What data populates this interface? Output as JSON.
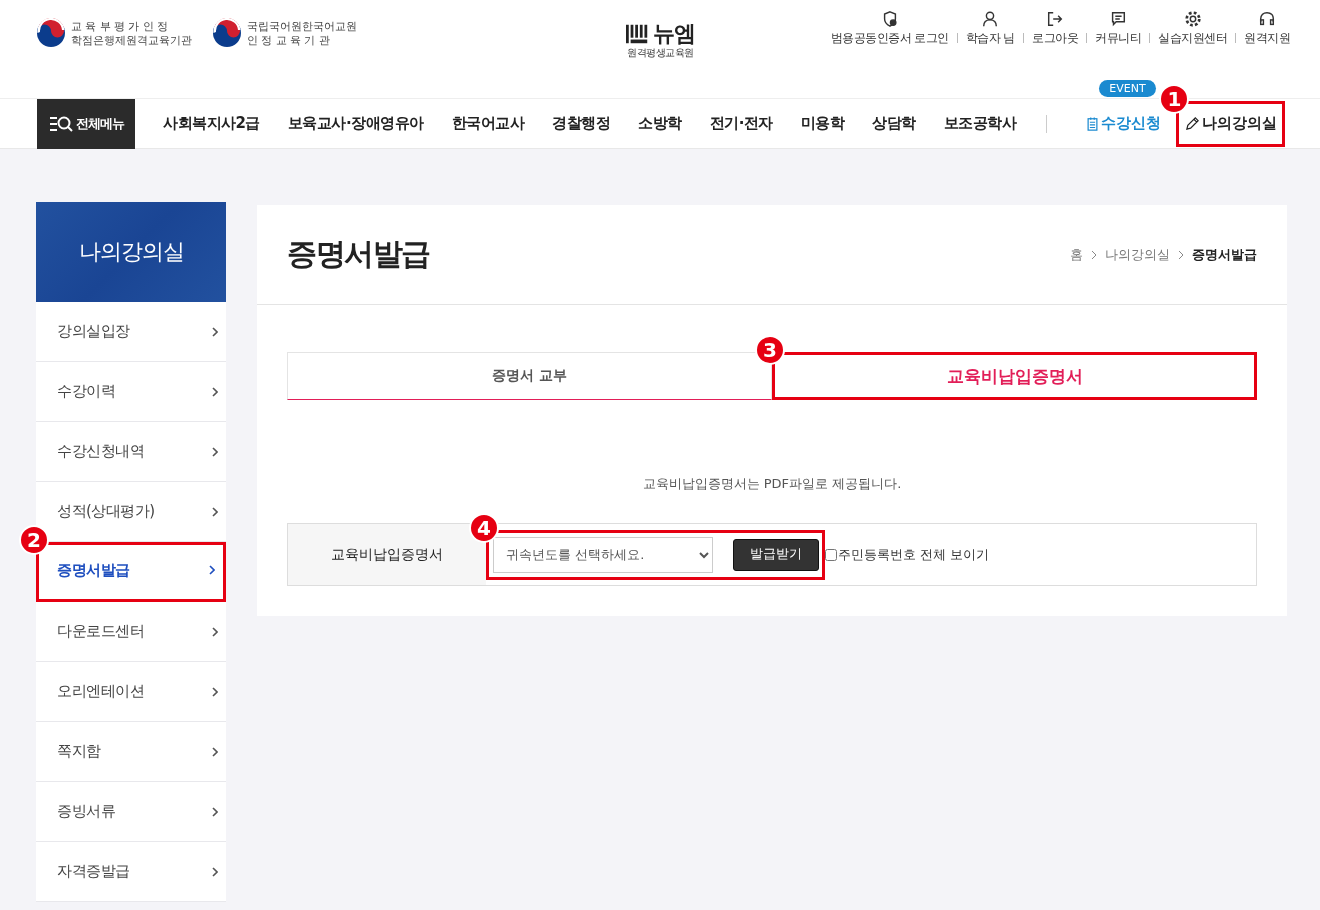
{
  "header": {
    "certs": [
      {
        "line1": "교 육 부 평 가 인 정",
        "line2": "학점은행제원격교육기관"
      },
      {
        "line1": "국립국어원한국어교원",
        "line2": "인 정 교 육 기 관"
      }
    ],
    "logo": {
      "name": "뉴엠",
      "subtitle": "원격평생교육원"
    },
    "utility_links": [
      {
        "kind": "cert",
        "label": "범용공동인증서 로그인"
      },
      {
        "kind": "user",
        "label": "학습자 님"
      },
      {
        "kind": "logout",
        "label": "로그아웃"
      },
      {
        "kind": "community",
        "label": "커뮤니티"
      },
      {
        "kind": "gear",
        "label": "실습지원센터"
      },
      {
        "kind": "headset",
        "label": "원격지원"
      }
    ]
  },
  "nav": {
    "menu_button": "전체메뉴",
    "items": [
      "사회복지사2급",
      "보육교사·장애영유아",
      "한국어교사",
      "경찰행정",
      "소방학",
      "전기·전자",
      "미용학",
      "상담학",
      "보조공학사"
    ],
    "enroll": {
      "label": "수강신청",
      "badge": "EVENT"
    },
    "my_classroom": {
      "label": "나의강의실",
      "callout": "1"
    }
  },
  "sidebar": {
    "title": "나의강의실",
    "items": [
      {
        "label": "강의실입장",
        "selected": false
      },
      {
        "label": "수강이력",
        "selected": false
      },
      {
        "label": "수강신청내역",
        "selected": false
      },
      {
        "label": "성적(상대평가)",
        "selected": false
      },
      {
        "label": "증명서발급",
        "selected": true,
        "callout": "2"
      },
      {
        "label": "다운로드센터",
        "selected": false
      },
      {
        "label": "오리엔테이션",
        "selected": false
      },
      {
        "label": "쪽지함",
        "selected": false
      },
      {
        "label": "증빙서류",
        "selected": false
      },
      {
        "label": "자격증발급",
        "selected": false
      }
    ]
  },
  "content": {
    "title": "증명서발급",
    "breadcrumb": [
      "홈",
      "나의강의실",
      "증명서발급"
    ],
    "tabs": [
      {
        "label": "증명서 교부",
        "selected": false
      },
      {
        "label": "교육비납입증명서",
        "selected": true,
        "callout": "3"
      }
    ],
    "notice": "교육비납입증명서는 PDF파일로 제공됩니다.",
    "form": {
      "label": "교육비납입증명서",
      "select_placeholder": "귀속년도를 선택하세요.",
      "button": "발급받기",
      "callout": "4",
      "checkbox": {
        "label": "주민등록번호 전체 보이기",
        "checked": false
      }
    }
  }
}
